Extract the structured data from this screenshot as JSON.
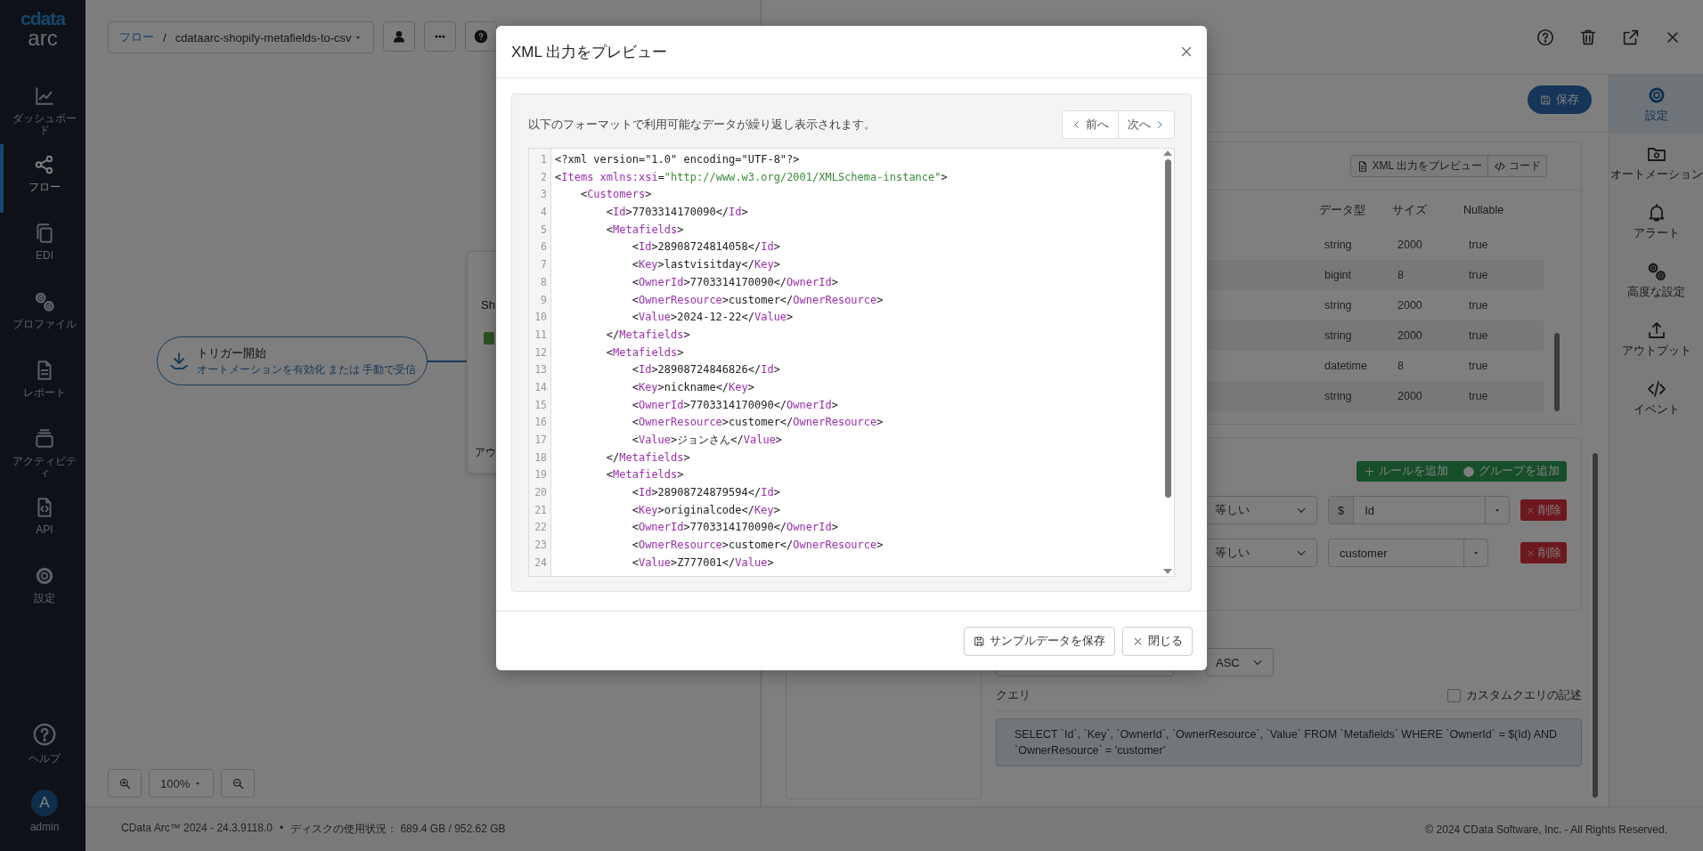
{
  "sidebar": {
    "logo": "cdata",
    "product": "arc",
    "items": [
      {
        "label": "ダッシュボード",
        "selected": false
      },
      {
        "label": "フロー",
        "selected": true
      },
      {
        "label": "EDI",
        "selected": false
      },
      {
        "label": "プロファイル",
        "selected": false
      },
      {
        "label": "レポート",
        "selected": false
      },
      {
        "label": "アクティビティ",
        "selected": false
      },
      {
        "label": "API",
        "selected": false
      },
      {
        "label": "設定",
        "selected": false
      }
    ],
    "help": "ヘルプ",
    "user": {
      "initial": "A",
      "name": "admin"
    }
  },
  "canvas": {
    "breadcrumb": {
      "root": "フロー",
      "separator": "/",
      "flow": "cdataarc-shopify-metafields-to-csv"
    },
    "trigger": {
      "title": "トリガー開始",
      "subtitle": "オートメーションを有効化 または 手動で受信"
    },
    "node": {
      "title": "Sh",
      "section": "アウ"
    },
    "zoom": "100%"
  },
  "panel": {
    "save": "保存",
    "preview_button": "XML 出力をプレビュー",
    "code_button": "コード",
    "table": {
      "columns": [
        "データ型",
        "サイズ",
        "Nullable"
      ],
      "rows": [
        [
          "string",
          "2000",
          "true"
        ],
        [
          "bigint",
          "8",
          "true"
        ],
        [
          "string",
          "2000",
          "true"
        ],
        [
          "string",
          "2000",
          "true"
        ],
        [
          "datetime",
          "8",
          "true"
        ],
        [
          "string",
          "2000",
          "true"
        ]
      ]
    },
    "filter": {
      "add_rule": "ルールを追加",
      "add_group": "グループを追加",
      "rules": [
        {
          "operator": "等しい",
          "prefix": "$",
          "value": "Id",
          "delete": "削除"
        },
        {
          "operator": "等しい",
          "value": "customer",
          "delete": "削除"
        }
      ]
    },
    "order": {
      "direction": "ASC"
    },
    "query": {
      "label": "クエリ",
      "custom_label": "カスタムクエリの記述",
      "custom_checked": false,
      "text": "SELECT `Id`, `Key`, `OwnerId`, `OwnerResource`, `Value` FROM `Metafields` WHERE `OwnerId` = $(Id) AND `OwnerResource` = 'customer'"
    }
  },
  "rail": [
    {
      "label": "設定",
      "selected": true
    },
    {
      "label": "オートメーション",
      "selected": false
    },
    {
      "label": "アラート",
      "selected": false
    },
    {
      "label": "高度な設定",
      "selected": false
    },
    {
      "label": "アウトプット",
      "selected": false
    },
    {
      "label": "イベント",
      "selected": false
    }
  ],
  "footer": {
    "version": "CData Arc™ 2024 - 24.3.9118.0",
    "separator": "•",
    "disk": "ディスクの使用状況： 689.4 GB / 952.62 GB",
    "copyright": "© 2024 CData Software, Inc. - All Rights Reserved."
  },
  "modal": {
    "title": "XML 出力をプレビュー",
    "description": "以下のフォーマットで利用可能なデータが繰り返し表示されます。",
    "prev": "前へ",
    "next": "次へ",
    "lines": [
      {
        "number": "1",
        "code": "<?xml version=\"1.0\" encoding=\"UTF-8\"?>"
      },
      {
        "number": "2",
        "code": "<Items xmlns:xsi=\"http://www.w3.org/2001/XMLSchema-instance\">"
      },
      {
        "number": "3",
        "code": "    <Customers>"
      },
      {
        "number": "4",
        "code": "        <Id>7703314170090</Id>"
      },
      {
        "number": "5",
        "code": "        <Metafields>"
      },
      {
        "number": "6",
        "code": "            <Id>28908724814058</Id>"
      },
      {
        "number": "7",
        "code": "            <Key>lastvisitday</Key>"
      },
      {
        "number": "8",
        "code": "            <OwnerId>7703314170090</OwnerId>"
      },
      {
        "number": "9",
        "code": "            <OwnerResource>customer</OwnerResource>"
      },
      {
        "number": "10",
        "code": "            <Value>2024-12-22</Value>"
      },
      {
        "number": "11",
        "code": "        </Metafields>"
      },
      {
        "number": "12",
        "code": "        <Metafields>"
      },
      {
        "number": "13",
        "code": "            <Id>28908724846826</Id>"
      },
      {
        "number": "14",
        "code": "            <Key>nickname</Key>"
      },
      {
        "number": "15",
        "code": "            <OwnerId>7703314170090</OwnerId>"
      },
      {
        "number": "16",
        "code": "            <OwnerResource>customer</OwnerResource>"
      },
      {
        "number": "17",
        "code": "            <Value>ジョンさん</Value>"
      },
      {
        "number": "18",
        "code": "        </Metafields>"
      },
      {
        "number": "19",
        "code": "        <Metafields>"
      },
      {
        "number": "20",
        "code": "            <Id>28908724879594</Id>"
      },
      {
        "number": "21",
        "code": "            <Key>originalcode</Key>"
      },
      {
        "number": "22",
        "code": "            <OwnerId>7703314170090</OwnerId>"
      },
      {
        "number": "23",
        "code": "            <OwnerResource>customer</OwnerResource>"
      },
      {
        "number": "24",
        "code": "            <Value>Z777001</Value>"
      }
    ],
    "buttons": [
      "サンプルデータを保存",
      "閉じる"
    ]
  }
}
